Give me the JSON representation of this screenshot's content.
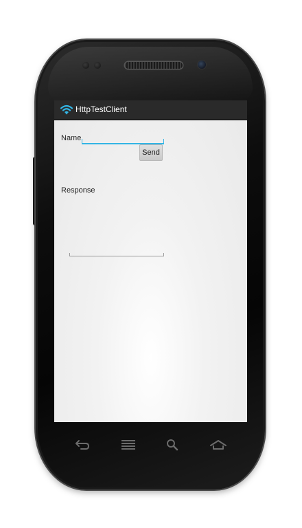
{
  "app": {
    "title": "HttpTestClient",
    "icon": "wifi-icon"
  },
  "form": {
    "name_label": "Name",
    "name_value": "",
    "send_label": "Send",
    "response_label": "Response",
    "response_value": ""
  },
  "navigation": {
    "buttons": [
      "back-icon",
      "menu-icon",
      "search-icon",
      "home-icon"
    ]
  },
  "colors": {
    "accent": "#33b5e5",
    "titlebar": "#2a2a2a",
    "screen_background": "#efefef",
    "phone_body": "#0d0d0d"
  }
}
